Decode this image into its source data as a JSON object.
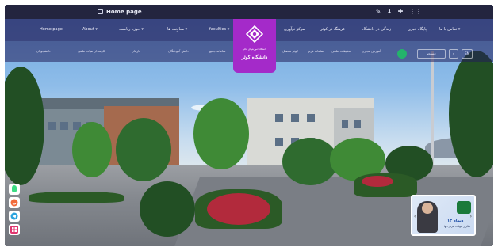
{
  "window": {
    "tab_title": "Home page",
    "icons": [
      "edit-icon",
      "download-icon",
      "plus-icon",
      "grid-icon"
    ]
  },
  "nav": {
    "left_items": [
      {
        "label": "Home page"
      },
      {
        "label": "About ▾"
      },
      {
        "label": "حوزه ریاست ▾"
      },
      {
        "label": "معاونت ها ▾"
      },
      {
        "label": "faculties ▾"
      }
    ],
    "right_items": [
      {
        "label": "مرکز نوآوری"
      },
      {
        "label": "فرهنگ در کوثر"
      },
      {
        "label": "زندگی در دانشگاه"
      },
      {
        "label": "پایگاه خبری"
      },
      {
        "label": "تماس با ما ▾"
      }
    ]
  },
  "subnav": {
    "items": [
      {
        "label": "دانشجویان"
      },
      {
        "label": "کارمندان هیات علمی"
      },
      {
        "label": "فارغان"
      },
      {
        "label": "دانش آموختگان"
      },
      {
        "label": "سامانه جامع"
      },
      {
        "label": "کوثر تحصیل"
      },
      {
        "label": "سامانه فرم"
      },
      {
        "label": "تحقیقات علمی"
      },
      {
        "label": "آموزش مجازی"
      }
    ],
    "controls": {
      "search_label": "جستجو",
      "lang_label": "EN"
    }
  },
  "logo": {
    "caption_small": "دانشگاه آموزشهای عالی",
    "caption_main": "دانشگاه کوثر"
  },
  "promo": {
    "title": "۱۳ دیماه",
    "subtitle": "سالروز شهادت سردار دلها"
  },
  "social": [
    "android-icon",
    "smiley-app-icon",
    "telegram-icon",
    "grid-app-icon"
  ],
  "colors": {
    "nav_bg": "#221e5a",
    "logo_bg": "#a42ac9",
    "accent_pink": "#e0488a"
  }
}
